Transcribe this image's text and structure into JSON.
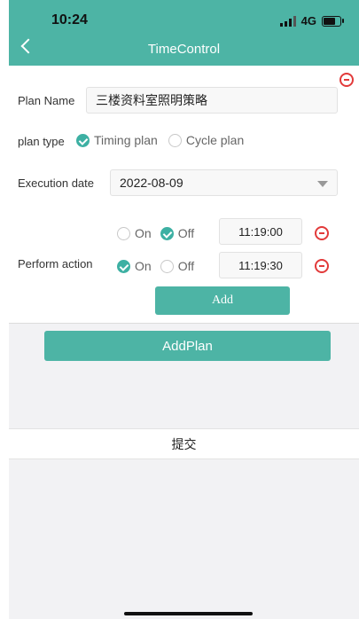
{
  "status_bar": {
    "time": "10:24",
    "network": "4G"
  },
  "nav": {
    "title": "TimeControl"
  },
  "form": {
    "plan_name_label": "Plan Name",
    "plan_name_value": "三楼资料室照明策略",
    "plan_type_label": "plan type",
    "plan_type_options": [
      "Timing plan",
      "Cycle plan"
    ],
    "plan_type_selected": "Timing plan",
    "execution_date_label": "Execution date",
    "execution_date_value": "2022-08-09",
    "perform_action_label": "Perform action",
    "actions": [
      {
        "on_label": "On",
        "off_label": "Off",
        "selected": "Off",
        "time": "11:19:00"
      },
      {
        "on_label": "On",
        "off_label": "Off",
        "selected": "On",
        "time": "11:19:30"
      }
    ],
    "add_label": "Add"
  },
  "add_plan_label": "AddPlan",
  "submit_label": "提交",
  "colors": {
    "accent": "#4db4a5",
    "remove": "#e23a3a"
  }
}
